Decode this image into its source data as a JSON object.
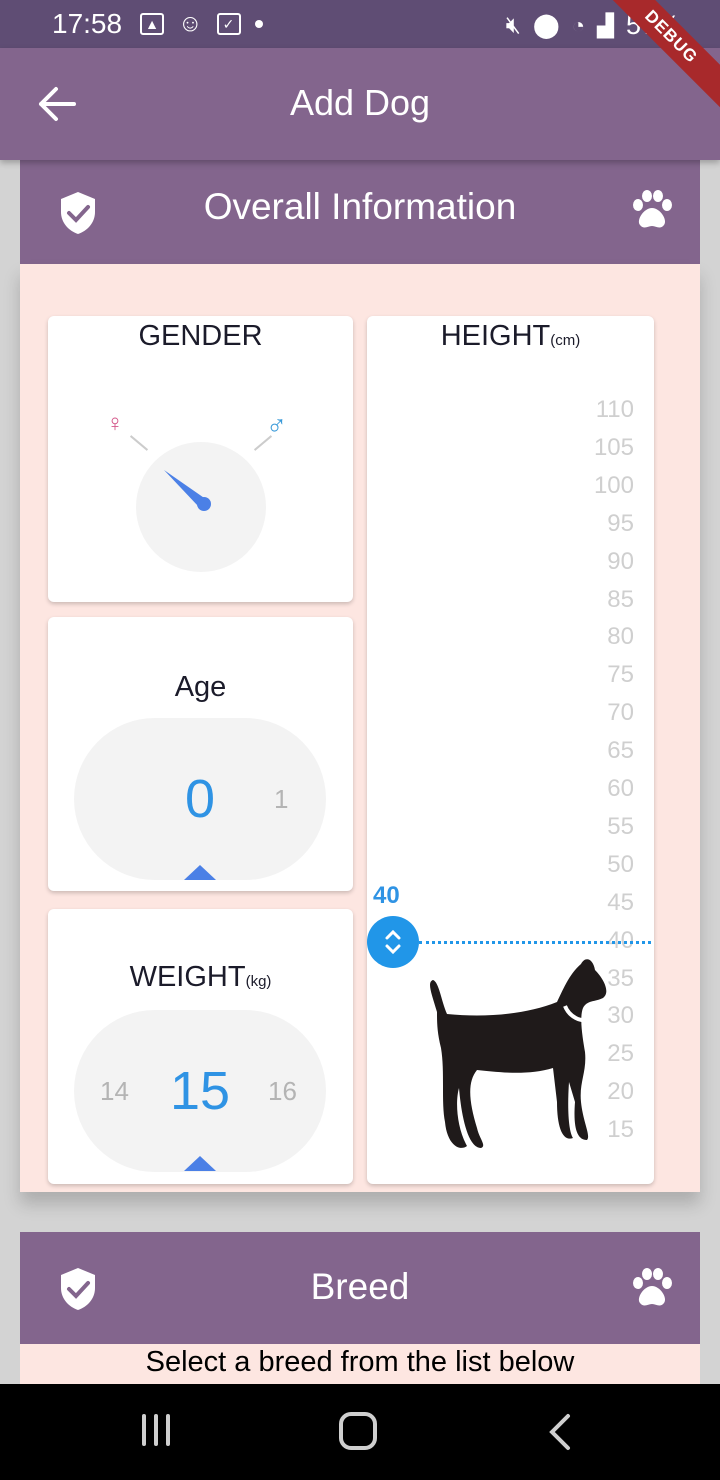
{
  "status_bar": {
    "time": "17:58",
    "battery": "57%"
  },
  "debug_banner": "DEBUG",
  "app_bar": {
    "title": "Add Dog"
  },
  "overall_section": {
    "title": "Overall Information"
  },
  "gender_card": {
    "title": "GENDER",
    "female_symbol": "♀",
    "male_symbol": "♂"
  },
  "age_card": {
    "title": "Age",
    "current": "0",
    "next": "1"
  },
  "weight_card": {
    "title": "WEIGHT",
    "unit": "(kg)",
    "prev": "14",
    "current": "15",
    "next": "16"
  },
  "height_card": {
    "title": "HEIGHT",
    "unit": "(cm)",
    "value": "40",
    "scale": [
      "110",
      "105",
      "100",
      "95",
      "90",
      "85",
      "80",
      "75",
      "70",
      "65",
      "60",
      "55",
      "50",
      "45",
      "40",
      "35",
      "30",
      "25",
      "20",
      "15"
    ]
  },
  "breed_section": {
    "title": "Breed",
    "instruction": "Select a breed from the list below"
  },
  "colors": {
    "app_bar": "#83658d",
    "panel_bg": "#fde6e1",
    "accent_blue": "#2196e8"
  }
}
